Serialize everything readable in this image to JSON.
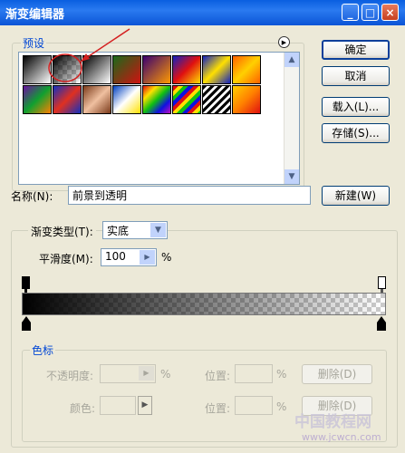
{
  "window": {
    "title": "渐变编辑器"
  },
  "presets": {
    "group_label": "预设"
  },
  "buttons": {
    "ok": "确定",
    "cancel": "取消",
    "load": "载入(L)...",
    "save": "存储(S)...",
    "new": "新建(W)",
    "delete_opacity": "删除(D)",
    "delete_color": "删除(D)"
  },
  "name_field": {
    "label": "名称(N):",
    "value": "前景到透明"
  },
  "gradient_type": {
    "label": "渐变类型(T):",
    "value": "实底"
  },
  "smoothness": {
    "label": "平滑度(M):",
    "value": "100",
    "unit": "%"
  },
  "color_stops": {
    "group_label": "色标",
    "opacity_label": "不透明度:",
    "opacity_unit": "%",
    "location_label_1": "位置:",
    "location_unit_1": "%",
    "color_label": "颜色:",
    "location_label_2": "位置:",
    "location_unit_2": "%"
  },
  "watermark": {
    "text": "中国教程网",
    "url": "www.jcwcn.com"
  },
  "colors": {
    "title_bar": "#0a5fe0",
    "dialog_bg": "#ece9d8",
    "group_label": "#0046d5",
    "annotation": "#d42020"
  }
}
